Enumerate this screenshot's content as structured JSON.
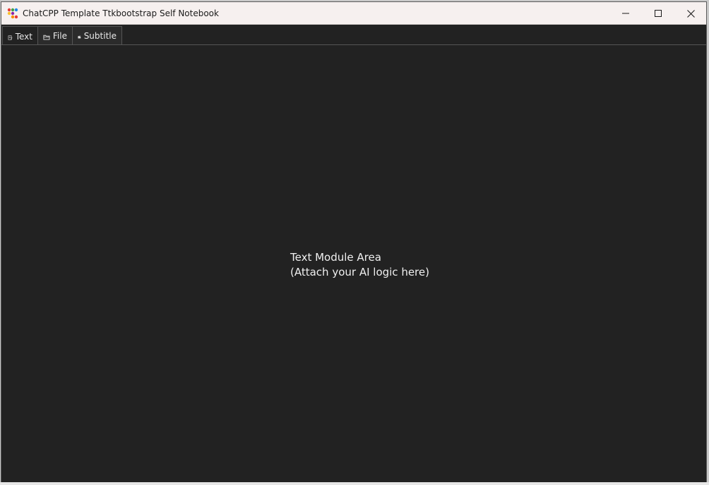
{
  "window": {
    "title": "ChatCPP Template Ttkbootstrap Self Notebook",
    "controls": {
      "minimize": "minimize",
      "maximize": "maximize",
      "close": "close"
    }
  },
  "tabs": [
    {
      "label": "Text",
      "icon": "document-icon",
      "active": true
    },
    {
      "label": "File",
      "icon": "folder-icon",
      "active": false
    },
    {
      "label": "Subtitle",
      "icon": "clapperboard-icon",
      "active": false
    }
  ],
  "main": {
    "module_line1": "Text Module Area",
    "module_line2": "(Attach your AI logic here)"
  },
  "colors": {
    "background": "#222222",
    "titlebar": "#f6f0ef",
    "text": "#f0f0f0",
    "tab_border": "#555555"
  }
}
